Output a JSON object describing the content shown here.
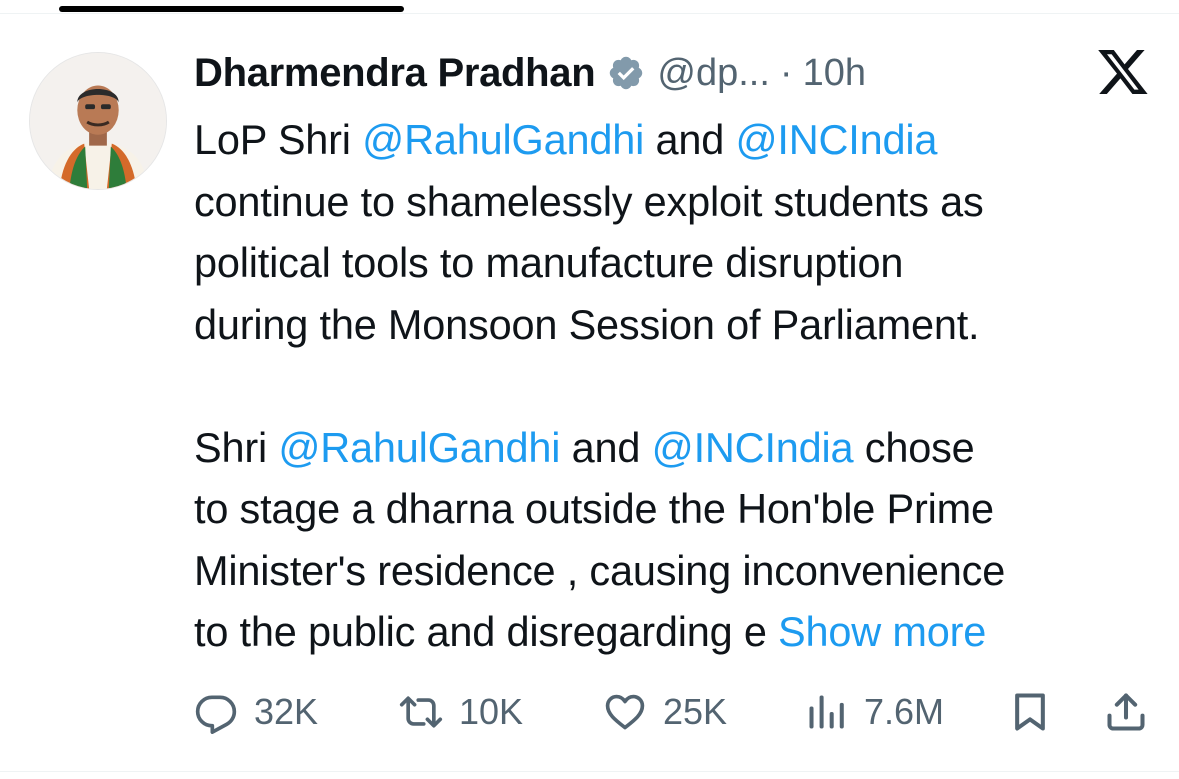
{
  "tweet": {
    "author_name": "Dharmendra Pradhan",
    "handle": "@dp...",
    "separator": "·",
    "time": "10h",
    "verified": true,
    "brand_logo": "x-logo-icon",
    "body_lines": [
      [
        {
          "t": "LoP Shri ",
          "k": "text"
        },
        {
          "t": "@RahulGandhi",
          "k": "mention"
        },
        {
          "t": " and ",
          "k": "text"
        },
        {
          "t": "@INCIndia",
          "k": "mention"
        }
      ],
      [
        {
          "t": "continue to shamelessly exploit students as",
          "k": "text"
        }
      ],
      [
        {
          "t": "political tools to manufacture disruption",
          "k": "text"
        }
      ],
      [
        {
          "t": "during the Monsoon Session of Parliament.",
          "k": "text"
        }
      ],
      [],
      [
        {
          "t": "Shri ",
          "k": "text"
        },
        {
          "t": "@RahulGandhi",
          "k": "mention"
        },
        {
          "t": " and ",
          "k": "text"
        },
        {
          "t": "@INCIndia",
          "k": "mention"
        },
        {
          "t": " chose",
          "k": "text"
        }
      ],
      [
        {
          "t": "to stage a dharna outside the Hon'ble Prime",
          "k": "text"
        }
      ],
      [
        {
          "t": "Minister's residence , causing inconvenience",
          "k": "text"
        }
      ],
      [
        {
          "t": "to the public and disregarding e ",
          "k": "text"
        },
        {
          "t": "Show more",
          "k": "show-more"
        }
      ]
    ]
  },
  "actions": {
    "reply": {
      "icon": "reply-icon",
      "count": "32K"
    },
    "repost": {
      "icon": "repost-icon",
      "count": "10K"
    },
    "like": {
      "icon": "heart-icon",
      "count": "25K"
    },
    "views": {
      "icon": "views-icon",
      "count": "7.6M"
    },
    "bookmark": {
      "icon": "bookmark-icon"
    },
    "share": {
      "icon": "share-icon"
    }
  },
  "colors": {
    "mention": "#1d9bf0",
    "secondary_text": "#536471",
    "primary_text": "#0f1419",
    "verified_badge": "#829aab"
  }
}
